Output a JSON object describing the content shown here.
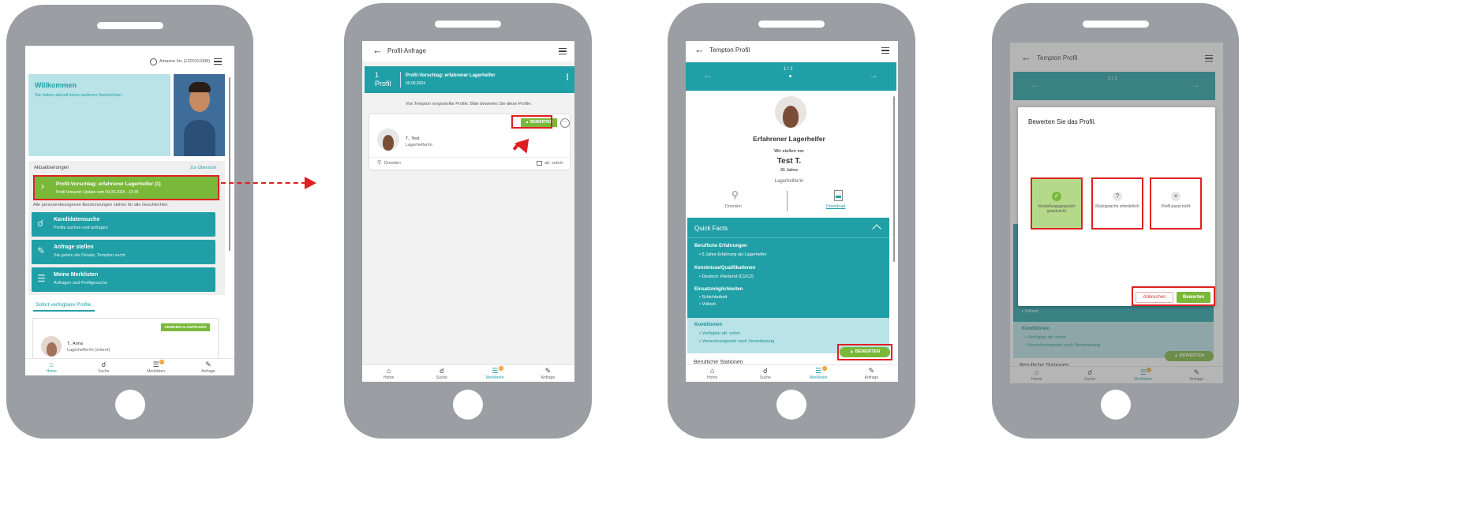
{
  "colors": {
    "teal": "#20a0a6",
    "light_teal": "#b9e3e6",
    "green": "#7ab83a",
    "highlight": "#e02020",
    "phone": "#9b9ea2",
    "badge": "#f39b2b"
  },
  "nav": [
    {
      "label": "Home",
      "icon": "home-icon"
    },
    {
      "label": "Suche",
      "icon": "search-icon"
    },
    {
      "label": "Merklisten",
      "icon": "list-icon",
      "badge": "0"
    },
    {
      "label": "Anfrage",
      "icon": "edit-icon"
    }
  ],
  "screen1": {
    "account": "Amazon Inc.(1200111008)",
    "welcome_title": "Willkommen",
    "welcome_text": "Sie haben aktuell keine weiteren Nachrichten.",
    "updates_label": "Aktualisierungen",
    "overview_link": "Zur Übersicht",
    "notification_title": "Profil-Vorschlag: erfahrener Lagerhelfer (1)",
    "notification_sub": "Profil-Versand: Update vom 09.09.2024 - 10:35",
    "gender_note": "Alle personenbezogenen Bezeichnungen stehen für alle Geschlechter.",
    "tiles": [
      {
        "title": "Kandidatensuche",
        "sub": "Profile suchen und anfragen"
      },
      {
        "title": "Anfrage stellen",
        "sub": "Sie geben die Details, Tempton sucht"
      },
      {
        "title": "Meine Merklisten",
        "sub": "Anfragen und Profilgesuche"
      }
    ],
    "available_label": "Sofort verfügbare Profile",
    "request_button": "ANSEHEN & ANFRAGEN",
    "profile_name": "T., Anna",
    "profile_role": "Lagerhelfer/in (erlernt)"
  },
  "screen2": {
    "title": "Profil-Anfrage",
    "count": "1",
    "count_label": "Profil",
    "request_title": "Profil-Vorschlag: erfahrener Lagerhelfer",
    "request_date": "09.09.2024",
    "intro": "Von Tempton vorgestellte Profile. Bitte bewerten Sie diese Profile.",
    "rate_button": "BEWERTEN",
    "name": "T., Test",
    "role": "Lagerhelfer/in",
    "location": "Dresden",
    "availability": "ab: sofort"
  },
  "screen3": {
    "title": "Tempton Profil",
    "pager": "1 / 1",
    "job_title": "Erfahrener Lagerhelfer",
    "presenting": "Wir stellen vor",
    "name": "Test T.",
    "age": "41 Jahre",
    "role": "Lagerhelfer/in",
    "location": "Dresden",
    "download": "Download",
    "quick_facts": "Quick Facts",
    "sections": [
      {
        "heading": "Berufliche Erfahrungen",
        "items": [
          "5 Jahre Erfahrung als Lagerhelfer"
        ]
      },
      {
        "heading": "Kenntnisse/Qualifikationen",
        "items": [
          "Deutsch: Fließend (C1/C2)"
        ]
      },
      {
        "heading": "Einsatzmöglichkeiten",
        "items": [
          "Schichtarbeit",
          "Vollzeit"
        ]
      }
    ],
    "conditions_heading": "Konditionen",
    "conditions": [
      "Verfügbar ab: sofort",
      "Verrechnungssatz nach Vereinbarung"
    ],
    "rate_button": "BEWERTEN",
    "next_section": "Berufliche Stationen"
  },
  "screen4": {
    "title": "Tempton Profil",
    "pager": "1 / 1",
    "dialog_title": "Bewerten Sie das Profil.",
    "options": [
      {
        "label": "Vorstellungsgespräch gewünscht",
        "icon": "check-icon"
      },
      {
        "label": "Rücksprache erforderlich",
        "icon": "question-icon"
      },
      {
        "label": "Profil passt nicht",
        "icon": "close-icon"
      }
    ],
    "cancel": "Abbrechen",
    "confirm": "Bewerten",
    "bg_item": "Vollzeit",
    "bg_conditions_heading": "Konditionen",
    "bg_conditions": [
      "Verfügbar ab: sofort",
      "Verrechnungssatz nach Vereinbarung"
    ],
    "bg_rate_button": "BEWERTEN",
    "bg_next_section": "Berufliche Stationen"
  }
}
